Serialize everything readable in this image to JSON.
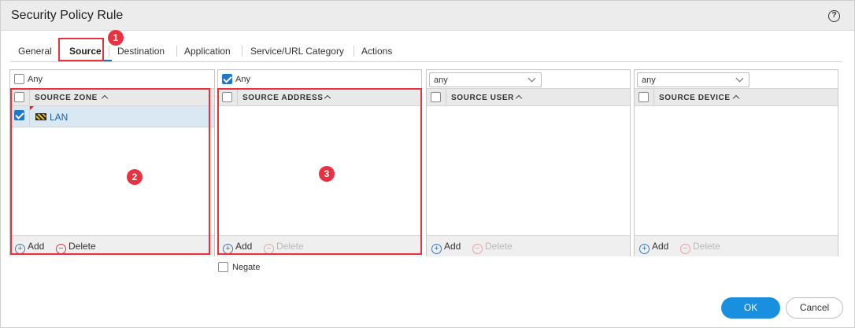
{
  "dialog": {
    "title": "Security Policy Rule",
    "help_icon": "question-circle-icon",
    "help_glyph": "?"
  },
  "tabs": [
    {
      "label": "General",
      "active": false
    },
    {
      "label": "Source",
      "active": true
    },
    {
      "label": "Destination",
      "active": false
    },
    {
      "label": "Application",
      "active": false
    },
    {
      "label": "Service/URL Category",
      "active": false
    },
    {
      "label": "Actions",
      "active": false
    }
  ],
  "panels": {
    "source_zone": {
      "any_label": "Any",
      "any_checked": false,
      "column_header": "SOURCE ZONE",
      "rows": [
        {
          "label": "LAN",
          "checked": true,
          "icon": "zone-icon"
        }
      ],
      "add_label": "Add",
      "delete_label": "Delete",
      "delete_enabled": true
    },
    "source_address": {
      "any_label": "Any",
      "any_checked": true,
      "column_header": "SOURCE ADDRESS",
      "rows": [],
      "add_label": "Add",
      "delete_label": "Delete",
      "delete_enabled": false
    },
    "source_user": {
      "select_value": "any",
      "column_header": "SOURCE USER",
      "rows": [],
      "add_label": "Add",
      "delete_label": "Delete",
      "delete_enabled": false
    },
    "source_device": {
      "select_value": "any",
      "column_header": "SOURCE DEVICE",
      "rows": [],
      "add_label": "Add",
      "delete_label": "Delete",
      "delete_enabled": false
    }
  },
  "negate": {
    "label": "Negate",
    "checked": false
  },
  "buttons": {
    "ok": "OK",
    "cancel": "Cancel"
  },
  "annotations": {
    "marker_1": "1",
    "marker_2": "2",
    "marker_3": "3",
    "highlight_color": "#e8323f"
  },
  "colors": {
    "accent": "#1a8fe0",
    "selected_row": "#d9e8f3",
    "link": "#1f5fa8"
  }
}
